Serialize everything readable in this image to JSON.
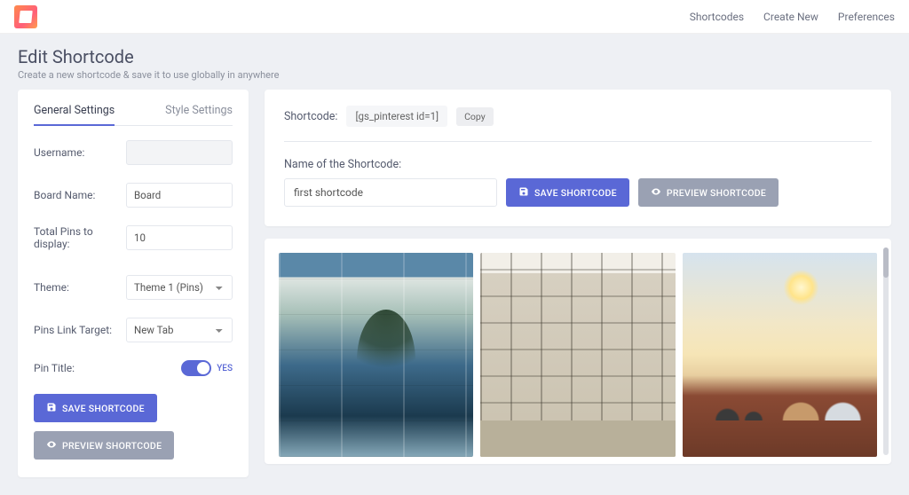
{
  "nav": {
    "links": [
      "Shortcodes",
      "Create New",
      "Preferences"
    ]
  },
  "page": {
    "title": "Edit Shortcode",
    "subtitle": "Create a new shortcode & save it to use globally in anywhere"
  },
  "sidebar": {
    "tabs": {
      "general": "General Settings",
      "style": "Style Settings"
    },
    "fields": {
      "username_label": "Username:",
      "username_value": "",
      "board_label": "Board Name:",
      "board_value": "Board",
      "total_label": "Total Pins to display:",
      "total_value": "10",
      "theme_label": "Theme:",
      "theme_value": "Theme 1 (Pins)",
      "target_label": "Pins Link Target:",
      "target_value": "New Tab",
      "pintitle_label": "Pin Title:",
      "pintitle_state": "YES"
    },
    "buttons": {
      "save": "SAVE SHORTCODE",
      "preview": "PREVIEW SHORTCODE"
    }
  },
  "main": {
    "shortcode_label": "Shortcode:",
    "shortcode_value": "[gs_pinterest id=1]",
    "copy": "Copy",
    "name_label": "Name of the Shortcode:",
    "name_value": "first shortcode",
    "buttons": {
      "save": "SAVE SHORTCODE",
      "preview": "PREVIEW SHORTCODE"
    }
  }
}
